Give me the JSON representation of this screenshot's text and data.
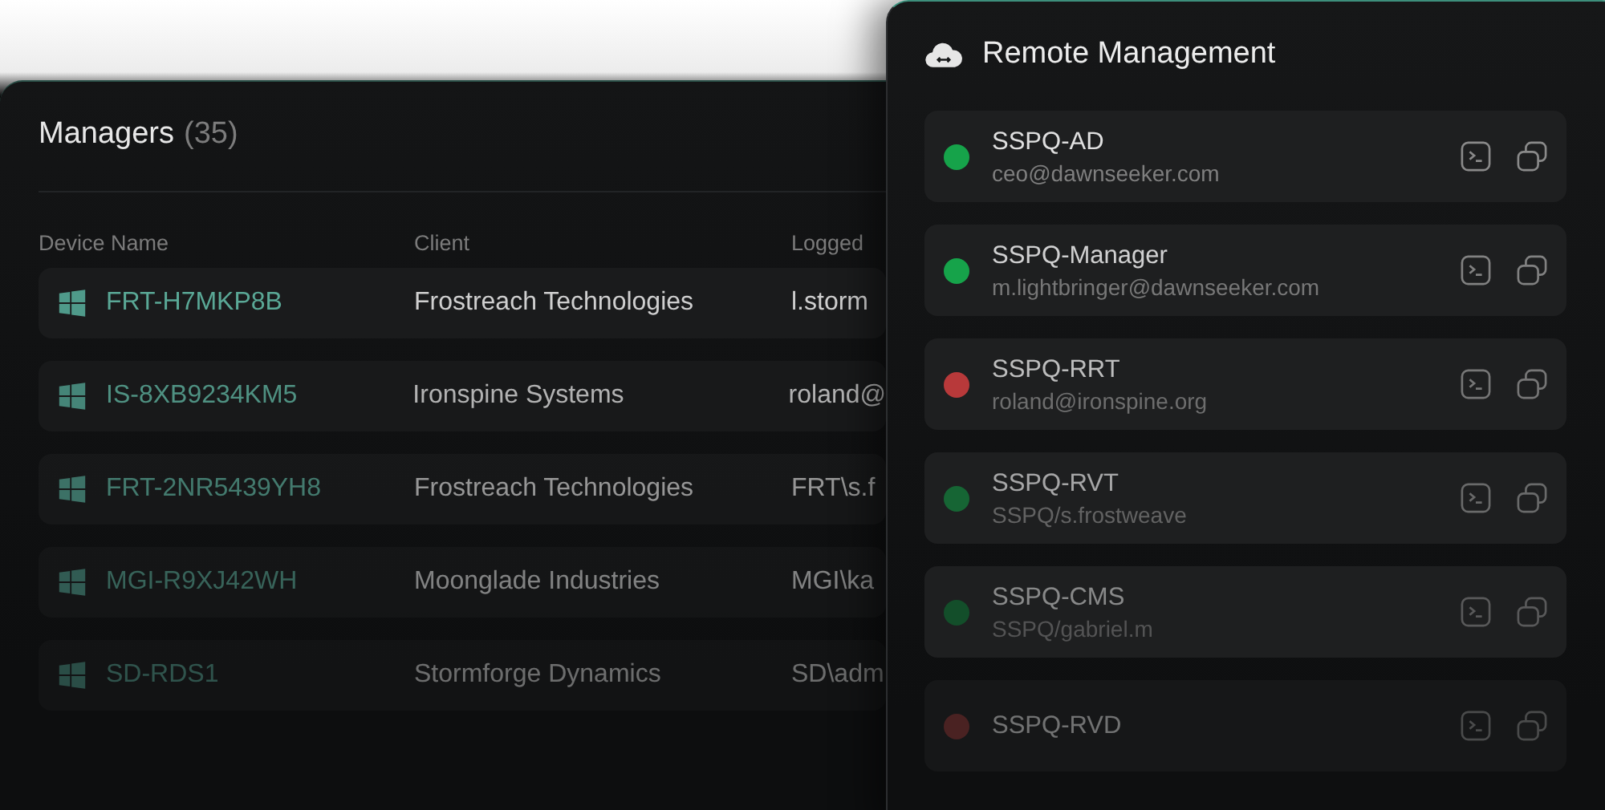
{
  "managers": {
    "title": "Managers",
    "count": "(35)",
    "columns": [
      "Device Name",
      "Client",
      "Logged"
    ],
    "rows": [
      {
        "device": "FRT-H7MKP8B",
        "client": "Frostreach Technologies",
        "logged": "l.storm"
      },
      {
        "device": "IS-8XB9234KM5",
        "client": "Ironspine Systems",
        "logged": "roland@"
      },
      {
        "device": "FRT-2NR5439YH8",
        "client": "Frostreach Technologies",
        "logged": "FRT\\s.f"
      },
      {
        "device": "MGI-R9XJ42WH",
        "client": "Moonglade Industries",
        "logged": "MGI\\ka"
      },
      {
        "device": "SD-RDS1",
        "client": "Stormforge Dynamics",
        "logged": "SD\\adm"
      }
    ]
  },
  "remote": {
    "title": "Remote Management",
    "items": [
      {
        "name": "SSPQ-AD",
        "user": "ceo@dawnseeker.com",
        "color": "#16a34a"
      },
      {
        "name": "SSPQ-Manager",
        "user": "m.lightbringer@dawnseeker.com",
        "color": "#16a34a"
      },
      {
        "name": "SSPQ-RRT",
        "user": "roland@ironspine.org",
        "color": "#b8393a"
      },
      {
        "name": "SSPQ-RVT",
        "user": "SSPQ/s.frostweave",
        "color": "#166534"
      },
      {
        "name": "SSPQ-CMS",
        "user": "SSPQ/gabriel.m",
        "color": "#134e2a"
      },
      {
        "name": "SSPQ-RVD",
        "color": "#4a2222"
      }
    ]
  }
}
